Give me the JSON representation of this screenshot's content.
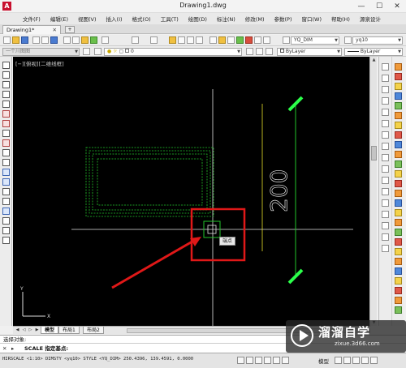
{
  "window": {
    "title": "Drawing1.dwg",
    "app_icon_letter": "A",
    "controls": [
      "—",
      "☐",
      "✕"
    ]
  },
  "menu": [
    "文件(F)",
    "编辑(E)",
    "视图(V)",
    "插入(I)",
    "格式(O)",
    "工具(T)",
    "绘图(D)",
    "标注(N)",
    "修改(M)",
    "参数(P)",
    "窗口(W)",
    "帮助(H)",
    "源泉设计"
  ],
  "tabs": {
    "document": "Drawing1*",
    "close": "✕"
  },
  "toolbar": {
    "dim_style": "YQ_DIM",
    "text_style": "yq10",
    "layer_state": "一个川图图",
    "layer": "0",
    "color": "ByLayer",
    "linetype": "ByLayer"
  },
  "canvas": {
    "view_label": "[−][俯视][二维线框]",
    "dimension_text": "200",
    "snap_tooltip": "端点",
    "background": "#000000",
    "colors": {
      "green": "#22c32a",
      "yellow": "#e6e02a",
      "white": "#e0e0e0",
      "red_box": "#e01818",
      "tick": "#2bff4a"
    }
  },
  "layout_tabs": [
    "模型",
    "布局1",
    "布局2"
  ],
  "command": {
    "history": "选择对象:",
    "prompt": "▸",
    "current": "SCALE 指定基点:"
  },
  "status": {
    "coordinates": "HIRSCALE <1:10> DIMSTY <yq10> STYLE <YQ_DIM>  250.4396, 139.4591, 0.0000",
    "model": "模型"
  },
  "watermark": {
    "main": "溜溜自学",
    "sub": "zixue.3d66.com"
  }
}
